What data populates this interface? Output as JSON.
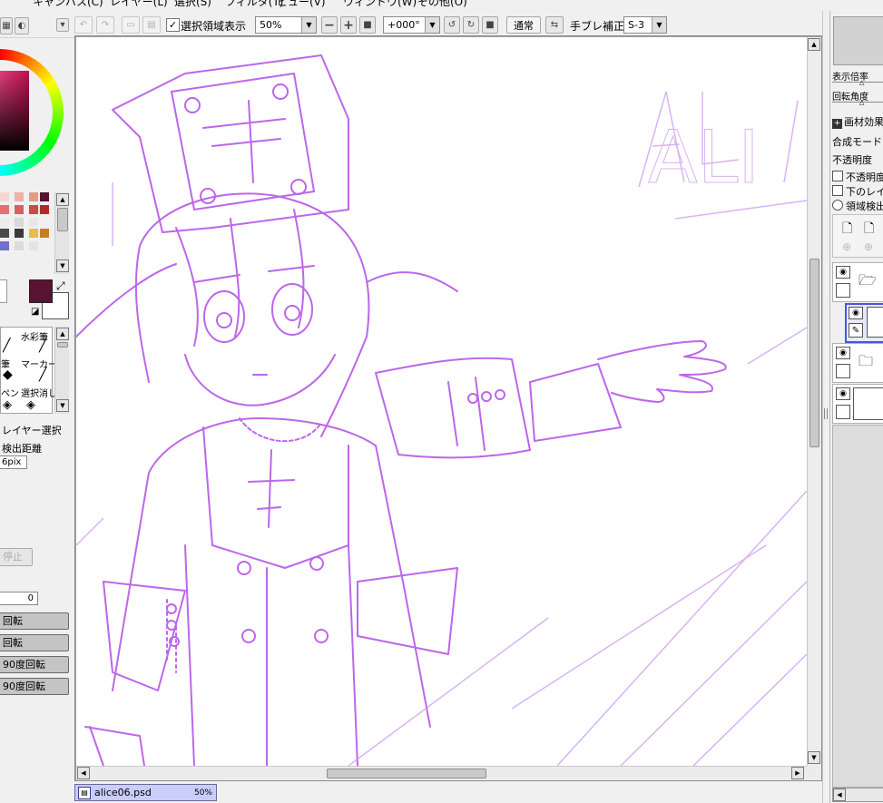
{
  "menu": [
    "キャンバス(C)",
    "レイヤー(L)",
    "選択(S)",
    "フィルタ(T)",
    "ビュー(V)",
    "ウィンドウ(W)",
    "その他(O)"
  ],
  "toolbar": {
    "selection_label": "選択領域表示",
    "selection_checked": true,
    "zoom_value": "50%",
    "rotation_value": "+000°",
    "blend_button": "通常",
    "stabilizer_label": "手ブレ補正",
    "stabilizer_value": "S-3"
  },
  "left_panel": {
    "tools": {
      "watercolor": "水彩筆",
      "brush": "筆",
      "marker": "マーカー",
      "pen": "ペン",
      "select_pen": "選択ペン",
      "select_erase": "選択消し"
    },
    "layer_select_label": "レイヤー選択",
    "detect_distance_label": "検出距離",
    "detect_distance_value": "6pix",
    "stop_button": "停止",
    "number_value": "0",
    "rotate_buttons": [
      "回転",
      "回転",
      "90度回転",
      "90度回転"
    ]
  },
  "canvas": {
    "document_name": "alice06.psd",
    "document_zoom": "50%",
    "sketch_text": "ALI"
  },
  "right_panel": {
    "display_scale_label": "表示倍率",
    "rotation_angle_label": "回転角度",
    "paper_effect_label": "画材効果",
    "blend_mode_label": "合成モード",
    "opacity_label": "不透明度",
    "opacity_protect_label": "不透明度保護",
    "clip_label": "下のレイヤーでクリッピング",
    "region_detect_label": "領域検出元に指定"
  },
  "colors": {
    "primary": "#5a1233",
    "secondary": "#ffffff",
    "sketch_line": "#b24ce8",
    "selected_layer": "#4a55d8",
    "doc_tab": "#c9cdf7"
  }
}
